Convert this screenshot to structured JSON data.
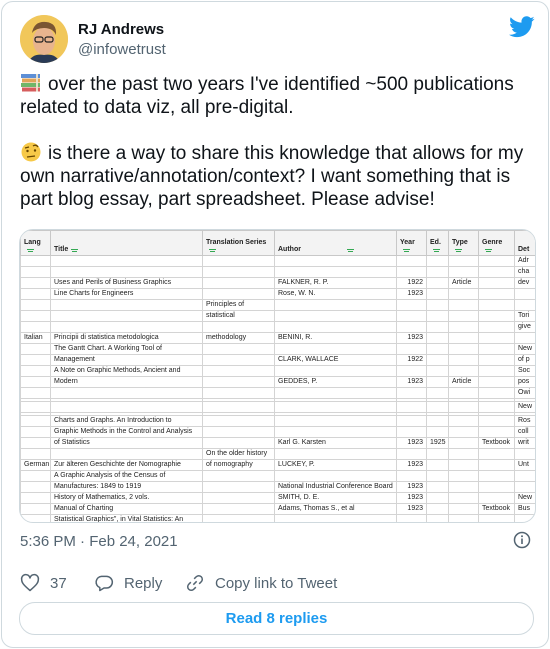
{
  "user": {
    "name": "RJ Andrews",
    "handle": "@infowetrust"
  },
  "tweet": {
    "paragraph1": "over the past two years I've identified ~500 publications related to data viz, all pre-digital.",
    "paragraph2": "is there a way to share this knowledge that allows for my own narrative/annotation/context? I want something that is part blog essay, part spreadsheet. Please advise!",
    "emoji1": "books-emoji",
    "emoji2": "raised-eyebrow-face-emoji"
  },
  "sheet": {
    "headers": [
      "Lang",
      "Title",
      "Translation Series",
      "Author",
      "Year",
      "Ed.",
      "Type",
      "Genre",
      "Det"
    ],
    "rows": [
      {
        "lang": "",
        "title": "",
        "series": "",
        "author": "",
        "year": "",
        "ed": "",
        "type": "",
        "genre": "",
        "det": "Adr"
      },
      {
        "lang": "",
        "title": "",
        "series": "",
        "author": "",
        "year": "",
        "ed": "",
        "type": "",
        "genre": "",
        "det": "cha"
      },
      {
        "lang": "",
        "title": "Uses and Perils of Business Graphics",
        "series": "",
        "author": "FALKNER, R. P.",
        "year": "1922",
        "ed": "",
        "type": "Article",
        "genre": "",
        "det": "dev"
      },
      {
        "lang": "",
        "title": "Line Charts for Engineers",
        "series": "",
        "author": "Rose, W. N.",
        "year": "1923",
        "ed": "",
        "type": "",
        "genre": "",
        "det": ""
      },
      {
        "lang": "",
        "title": "",
        "series": "Principles of",
        "author": "",
        "year": "",
        "ed": "",
        "type": "",
        "genre": "",
        "det": ""
      },
      {
        "lang": "",
        "title": "",
        "series": "statistical",
        "author": "",
        "year": "",
        "ed": "",
        "type": "",
        "genre": "",
        "det": "Tori"
      },
      {
        "lang": "",
        "title": "",
        "series": "",
        "author": "",
        "year": "",
        "ed": "",
        "type": "",
        "genre": "",
        "det": "give"
      },
      {
        "lang": "Italian",
        "title": "Principii di statistica metodologica",
        "series": "methodology",
        "author": "BENINI, R.",
        "year": "1923",
        "ed": "",
        "type": "",
        "genre": "",
        "det": ""
      },
      {
        "lang": "",
        "title": "The Gantt Chart. A Working Tool of",
        "series": "",
        "author": "",
        "year": "",
        "ed": "",
        "type": "",
        "genre": "",
        "det": "New"
      },
      {
        "lang": "",
        "title": "Management",
        "series": "",
        "author": "CLARK, WALLACE",
        "year": "1922",
        "ed": "",
        "type": "",
        "genre": "",
        "det": "of p"
      },
      {
        "lang": "",
        "title": "A Note on Graphic Methods, Ancient and",
        "series": "",
        "author": "",
        "year": "",
        "ed": "",
        "type": "",
        "genre": "",
        "det": "Soc"
      },
      {
        "lang": "",
        "title": "Modern",
        "series": "",
        "author": "GEDDES, P.",
        "year": "1923",
        "ed": "",
        "type": "Article",
        "genre": "",
        "det": "pos"
      },
      {
        "lang": "",
        "title": "",
        "series": "",
        "author": "",
        "year": "",
        "ed": "",
        "type": "",
        "genre": "",
        "det": "Owi"
      },
      {
        "lang": "",
        "title": "",
        "series": "",
        "author": "",
        "year": "",
        "ed": "",
        "type": "",
        "genre": "",
        "det": ""
      },
      {
        "lang": "",
        "title": "",
        "series": "",
        "author": "",
        "year": "",
        "ed": "",
        "type": "",
        "genre": "",
        "det": "New"
      },
      {
        "lang": "",
        "title": "",
        "series": "",
        "author": "",
        "year": "",
        "ed": "",
        "type": "",
        "genre": "",
        "det": ""
      },
      {
        "lang": "",
        "title": "Charts and Graphs. An Introduction to",
        "series": "",
        "author": "",
        "year": "",
        "ed": "",
        "type": "",
        "genre": "",
        "det": "Ros"
      },
      {
        "lang": "",
        "title": "Graphic Methods in the Control and Analysis",
        "series": "",
        "author": "",
        "year": "",
        "ed": "",
        "type": "",
        "genre": "",
        "det": "coll"
      },
      {
        "lang": "",
        "title": "of Statistics",
        "series": "",
        "author": "Karl G. Karsten",
        "year": "1923",
        "ed": "1925",
        "type": "",
        "genre": "Textbook",
        "det": "writ"
      },
      {
        "lang": "",
        "title": "",
        "series": "On the older history",
        "author": "",
        "year": "",
        "ed": "",
        "type": "",
        "genre": "",
        "det": ""
      },
      {
        "lang": "German",
        "title": "Zur älteren Geschichte der Nomographie",
        "series": "of nomography",
        "author": "LUCKEY, P.",
        "year": "1923",
        "ed": "",
        "type": "",
        "genre": "",
        "det": "Unt"
      },
      {
        "lang": "",
        "title": "A Graphic Analysis of the Census of",
        "series": "",
        "author": "",
        "year": "",
        "ed": "",
        "type": "",
        "genre": "",
        "det": ""
      },
      {
        "lang": "",
        "title": "Manufactures: 1849 to 1919",
        "series": "",
        "author": "National Industrial Conference Board",
        "year": "1923",
        "ed": "",
        "type": "",
        "genre": "",
        "det": ""
      },
      {
        "lang": "",
        "title": "History of Mathematics, 2 vols.",
        "series": "",
        "author": "SMITH, D. E.",
        "year": "1923",
        "ed": "",
        "type": "",
        "genre": "",
        "det": "New"
      },
      {
        "lang": "",
        "title": "Manual of Charting",
        "series": "",
        "author": "Adams, Thomas S., et al",
        "year": "1923",
        "ed": "",
        "type": "",
        "genre": "Textbook",
        "det": "Bus"
      },
      {
        "lang": "",
        "title": "Statistical Graphics\", in Vital Statistics: An",
        "series": "",
        "author": "",
        "year": "",
        "ed": "",
        "type": "",
        "genre": "",
        "det": ""
      },
      {
        "lang": "",
        "title": "Intro- duction to the Science of Demography,",
        "series": "",
        "author": "",
        "year": "",
        "ed": "",
        "type": "",
        "genre": "",
        "det": ""
      },
      {
        "lang": "",
        "title": "2nd ed.",
        "series": "",
        "author": "WHIPPLE, G. C.",
        "year": "1923",
        "ed": "",
        "type": "",
        "genre": "",
        "det": "New"
      }
    ]
  },
  "timestamp": "5:36 PM · Feb 24, 2021",
  "actions": {
    "likes": "37",
    "reply": "Reply",
    "copy_link": "Copy link to Tweet"
  },
  "read_replies": "Read 8 replies",
  "colors": {
    "twitter_blue": "#1d9bf0",
    "like_red": "#f91880",
    "muted": "#536471",
    "text": "#0f1419",
    "border": "#cfd9de"
  }
}
